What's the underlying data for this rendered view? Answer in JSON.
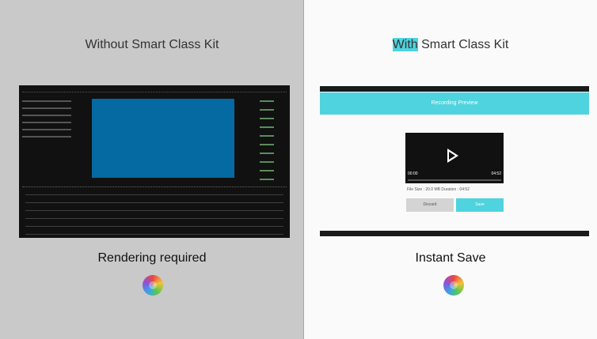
{
  "left": {
    "heading": "Without Smart Class Kit",
    "caption": "Rendering required"
  },
  "right": {
    "heading_prefix": "With",
    "heading_rest": " Smart Class Kit",
    "caption": "Instant Save",
    "preview": {
      "header": "Recording Preview",
      "time_start": "00:00",
      "time_end": "04:52",
      "progress": 0.0,
      "meta": "File Size : 20.0 MB Duration : 04:52",
      "discard_label": "Discard",
      "save_label": "Save"
    }
  },
  "colors": {
    "accent": "#4fd3de",
    "viewport": "#046aa1",
    "left_bg": "#c9c9c9"
  },
  "icons": [
    "play-icon",
    "spinning-wheel-icon"
  ]
}
